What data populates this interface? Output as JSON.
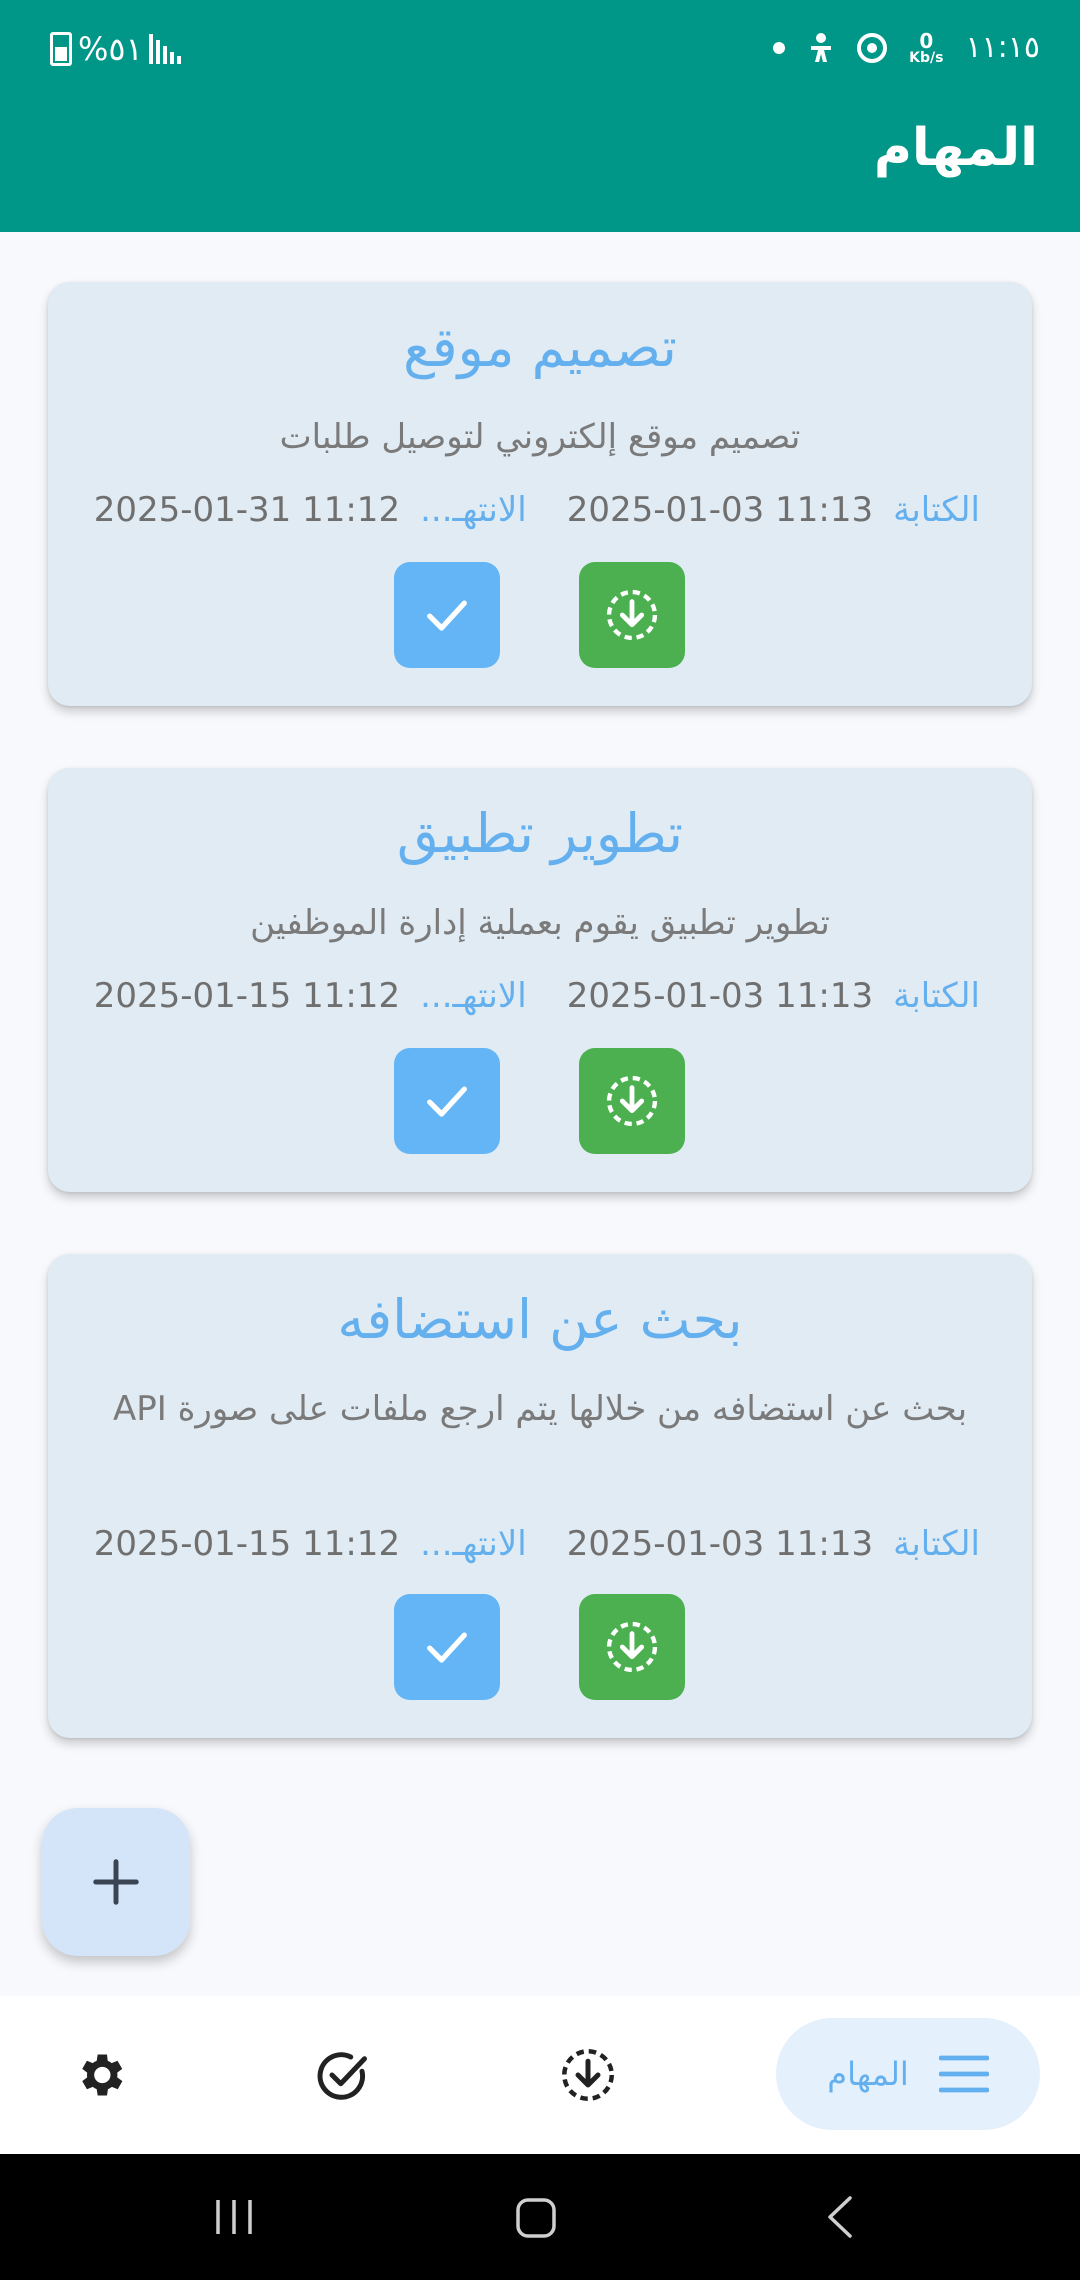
{
  "status_bar": {
    "time": "١١:١٥",
    "speed_value": "0",
    "speed_unit": "Kb/s",
    "battery_text": "%٥١"
  },
  "app_bar": {
    "title": "المهام",
    "color": "#009688"
  },
  "tasks": [
    {
      "title": "تصميم موقع",
      "description": "تصميم موقع إلكتروني لتوصيل طلبات",
      "created_label": "الكتابة",
      "created_value": "2025-01-03 11:13",
      "end_label": "الانتهـ...",
      "end_value": "2025-01-31 11:12"
    },
    {
      "title": "تطوير تطبيق",
      "description": "تطوير تطبيق يقوم بعملية إدارة الموظفين",
      "created_label": "الكتابة",
      "created_value": "2025-01-03 11:13",
      "end_label": "الانتهـ...",
      "end_value": "2025-01-15 11:12"
    },
    {
      "title": "بحث عن استضافه",
      "description": "بحث عن استضافه من خلالها يتم ارجع ملفات على صورة API",
      "created_label": "الكتابة",
      "created_value": "2025-01-03 11:13",
      "end_label": "الانتهـ...",
      "end_value": "2025-01-15 11:12"
    }
  ],
  "bottom_nav": {
    "active_label": "المهام"
  },
  "icons": {
    "complete": "check-icon",
    "archive": "archive-download-icon",
    "add": "plus-icon",
    "settings": "gear-icon",
    "done": "check-circle-icon",
    "menu": "menu-icon"
  },
  "colors": {
    "accent": "#64b5f6",
    "archive": "#4caf50",
    "card": "#e1ebf3"
  }
}
